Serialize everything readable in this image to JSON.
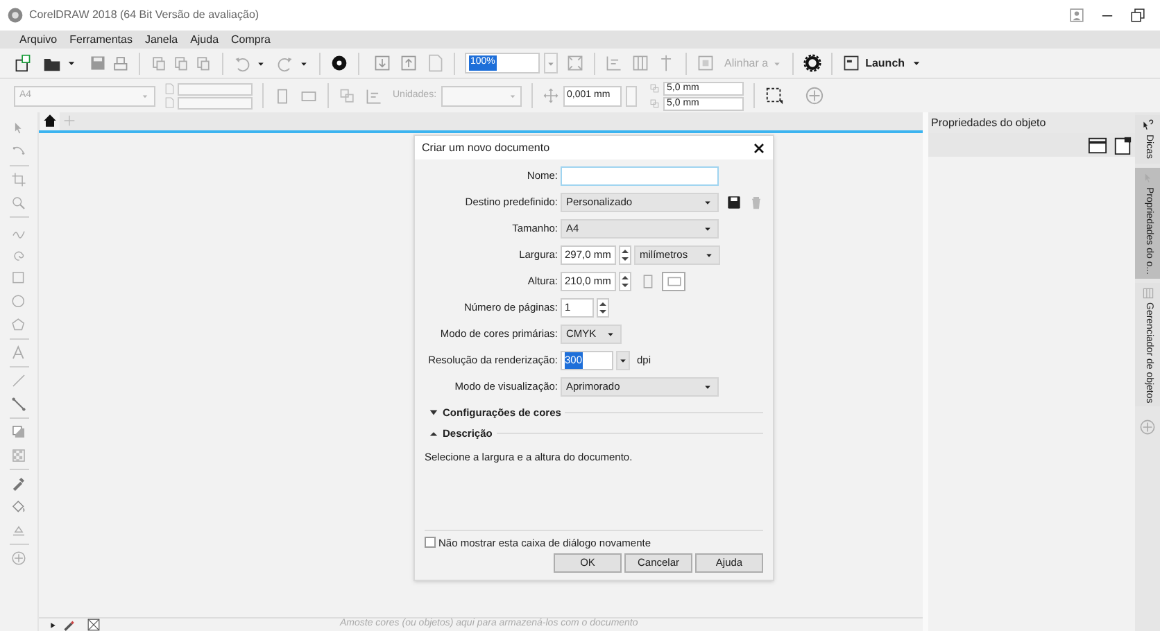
{
  "window": {
    "title": "CorelDRAW 2018 (64 Bit Versão de avaliação)"
  },
  "menu": [
    "Arquivo",
    "Ferramentas",
    "Janela",
    "Ajuda",
    "Compra"
  ],
  "toolbar": {
    "zoom": "100%",
    "align": "Alinhar a",
    "launch": "Launch"
  },
  "property_bar": {
    "page_size": "A4",
    "units_label": "Unidades:",
    "nudge": "0,001 mm",
    "duplicate_x": "5,0 mm",
    "duplicate_y": "5,0 mm"
  },
  "docker": {
    "title": "Propriedades do objeto",
    "tabs": [
      {
        "label": "Dicas",
        "selected": false
      },
      {
        "label": "Propriedades do o...",
        "selected": true
      },
      {
        "label": "Gerenciador de objetos",
        "selected": false
      }
    ]
  },
  "dialog": {
    "title": "Criar um novo documento",
    "fields": [
      {
        "kind": "text",
        "label": "Nome:"
      },
      {
        "kind": "preset",
        "label": "Destino predefinido:",
        "value": "Personalizado"
      },
      {
        "kind": "dropdown",
        "label": "Tamanho:",
        "value": "A4"
      },
      {
        "kind": "spin_unit",
        "label": "Largura:",
        "value": "297,0 mm",
        "unit": "milímetros"
      },
      {
        "kind": "spin_orientation",
        "label": "Altura:",
        "value": "210,0 mm",
        "landscape": true
      },
      {
        "kind": "spin",
        "label": "Número de páginas:",
        "value": "1"
      },
      {
        "kind": "short_dropdown",
        "label": "Modo de cores primárias:",
        "value": "CMYK"
      },
      {
        "kind": "combo",
        "label": "Resolução da renderização:",
        "value": "300",
        "unit": "dpi"
      },
      {
        "kind": "dropdown",
        "label": "Modo de visualização:",
        "value": "Aprimorado"
      }
    ],
    "sections": [
      {
        "title": "Configurações de cores",
        "expanded": false
      },
      {
        "title": "Descrição",
        "expanded": true
      }
    ],
    "description": "Selecione a largura e a altura do documento.",
    "checkbox": {
      "label": "Não mostrar esta caixa de diálogo novamente",
      "checked": false
    },
    "buttons": [
      "OK",
      "Cancelar",
      "Ajuda"
    ]
  },
  "palette_hint": "Amoste cores (ou objetos) aqui para armazená-los com o documento"
}
